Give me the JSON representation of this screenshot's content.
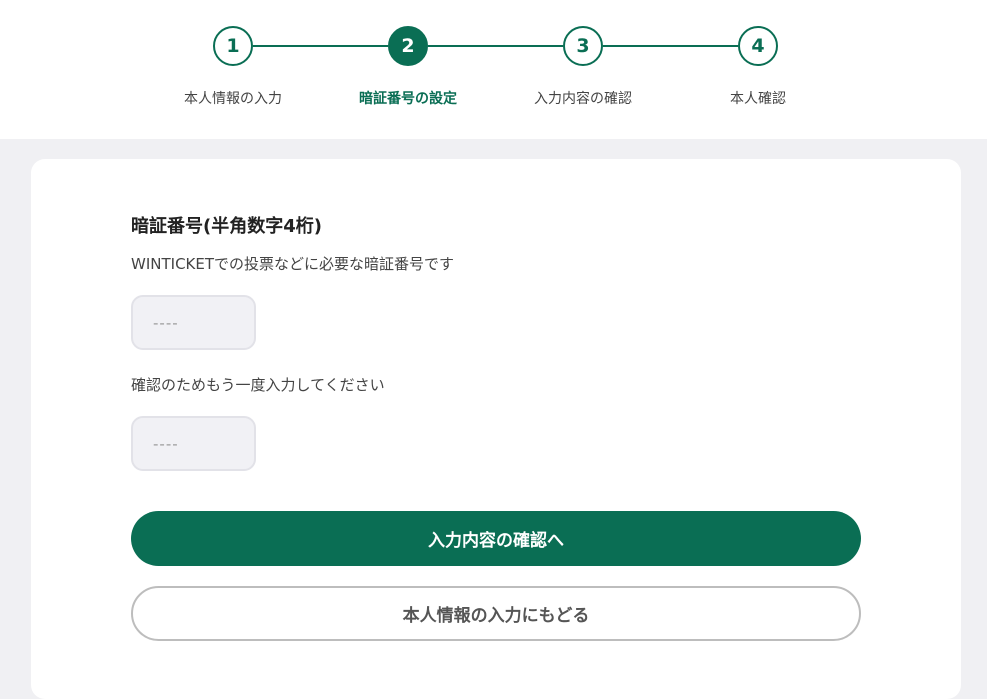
{
  "stepper": {
    "steps": [
      {
        "number": "1",
        "label": "本人情報の入力"
      },
      {
        "number": "2",
        "label": "暗証番号の設定"
      },
      {
        "number": "3",
        "label": "入力内容の確認"
      },
      {
        "number": "4",
        "label": "本人確認"
      }
    ],
    "active_step": "2"
  },
  "form": {
    "title": "暗証番号(半角数字4桁)",
    "description": "WINTICKETでの投票などに必要な暗証番号です",
    "pin_placeholder": "----",
    "confirm_label": "確認のためもう一度入力してください",
    "confirm_placeholder": "----"
  },
  "actions": {
    "primary_label": "入力内容の確認へ",
    "secondary_label": "本人情報の入力にもどる"
  },
  "colors": {
    "accent": "#0a6e54",
    "background": "#f0f0f3",
    "card": "#ffffff",
    "input_bg": "#f1f1f5"
  }
}
